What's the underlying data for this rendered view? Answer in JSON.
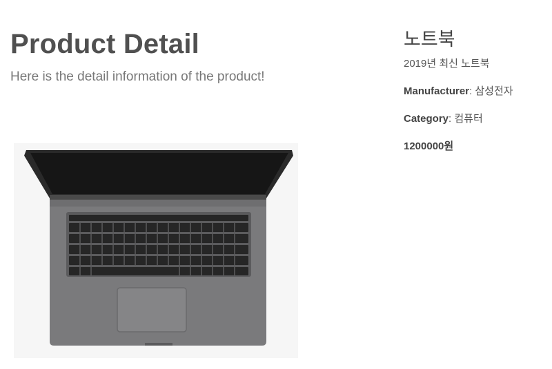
{
  "header": {
    "title": "Product Detail",
    "subtitle": "Here is the detail information of the product!"
  },
  "product": {
    "image_alt": "laptop-photo",
    "name": "노트북",
    "description": "2019년 최신 노트북",
    "manufacturer_label": "Manufacturer",
    "manufacturer": "삼성전자",
    "category_label": "Category",
    "category": "컴퓨터",
    "price": "1200000원"
  }
}
